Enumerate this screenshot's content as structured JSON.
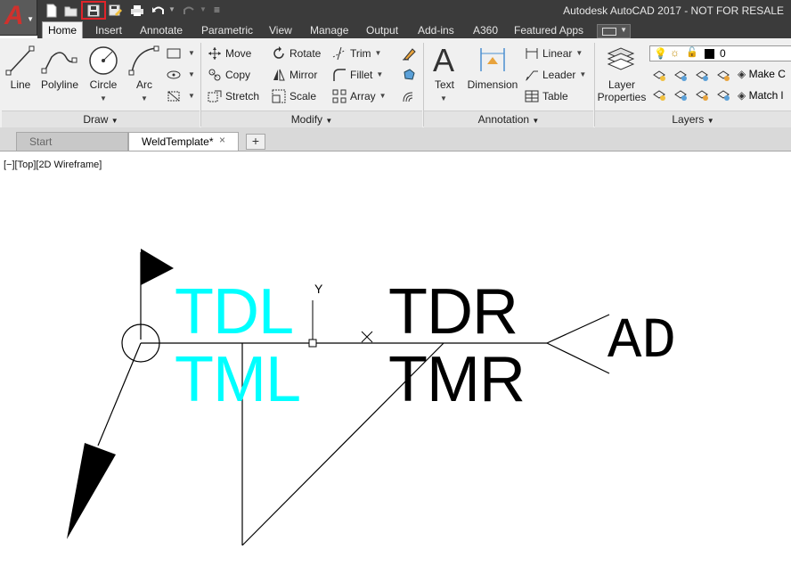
{
  "window": {
    "title": "Autodesk AutoCAD 2017 - NOT FOR RESALE",
    "app_letter": "A"
  },
  "ribbon_tabs": [
    "Home",
    "Insert",
    "Annotate",
    "Parametric",
    "View",
    "Manage",
    "Output",
    "Add-ins",
    "A360",
    "Featured Apps"
  ],
  "ribbon": {
    "draw": {
      "title": "Draw",
      "tools": [
        "Line",
        "Polyline",
        "Circle",
        "Arc"
      ]
    },
    "modify": {
      "title": "Modify",
      "tools": [
        "Move",
        "Rotate",
        "Trim",
        "Copy",
        "Mirror",
        "Fillet",
        "Stretch",
        "Scale",
        "Array"
      ]
    },
    "annotation": {
      "title": "Annotation",
      "text": "Text",
      "dimension": "Dimension",
      "linear": "Linear",
      "leader": "Leader",
      "table": "Table"
    },
    "layers": {
      "title": "Layers",
      "layer_properties_1": "Layer",
      "layer_properties_2": "Properties",
      "current_layer": "0",
      "make_current": "Make C",
      "match": "Match l"
    }
  },
  "file_tabs": {
    "start": "Start",
    "active": "WeldTemplate*",
    "close": "×",
    "add": "+"
  },
  "viewport": {
    "label": "[−][Top][2D Wireframe]",
    "ucs_y": "Y"
  },
  "drawing_text": {
    "tdl": "TDL",
    "tml": "TML",
    "tdr": "TDR",
    "tmr": "TMR",
    "ad": "AD"
  },
  "colors": {
    "cyan_text": "#00ffff",
    "highlight": "#e0242a",
    "app_red": "#d0312d"
  }
}
